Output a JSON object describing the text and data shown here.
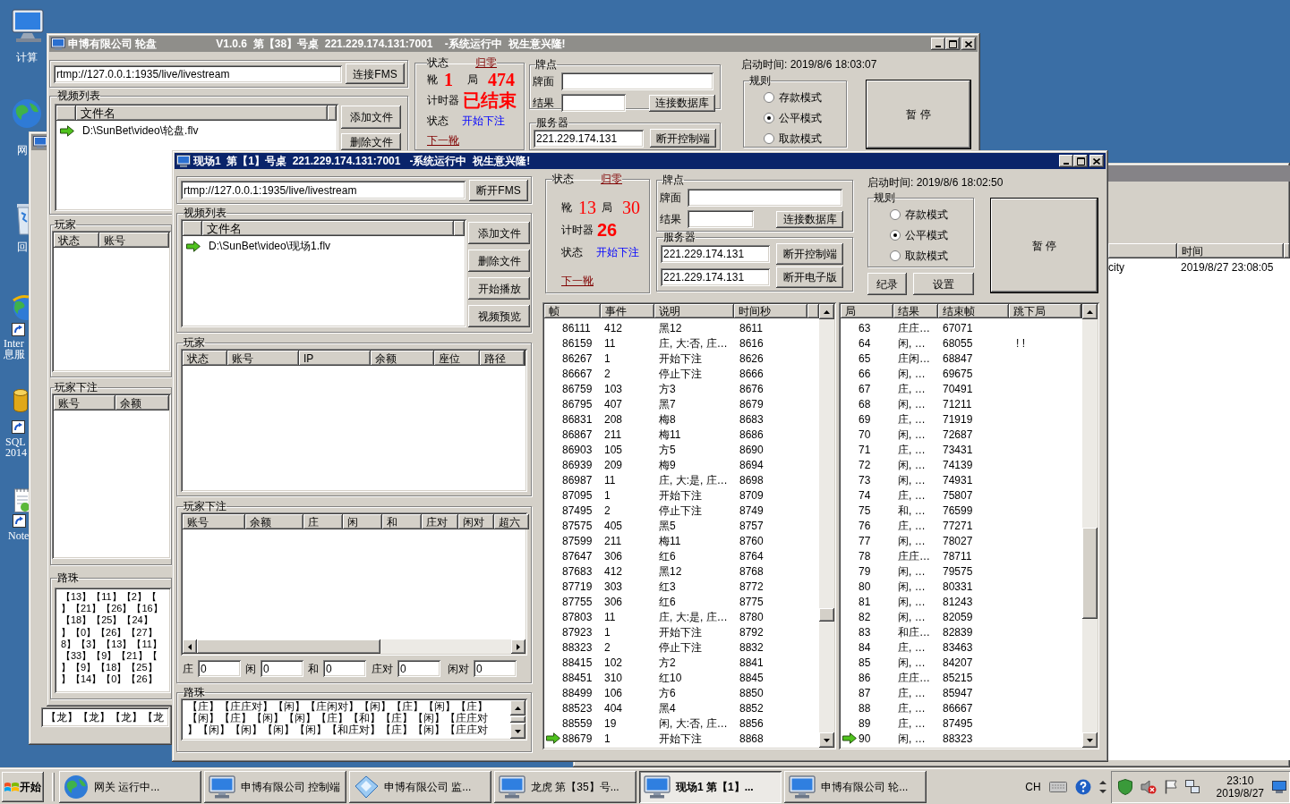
{
  "desktop_icons": [
    {
      "kind": "computer",
      "shortcut": false,
      "lines": [
        "计算"
      ]
    },
    {
      "kind": "network",
      "shortcut": false,
      "lines": [
        "网"
      ]
    },
    {
      "kind": "recycle-bin",
      "shortcut": false,
      "lines": [
        "回"
      ]
    },
    {
      "kind": "globe-app",
      "shortcut": true,
      "lines": [
        "Inter",
        "息服"
      ]
    },
    {
      "kind": "database",
      "shortcut": true,
      "lines": [
        "SQL",
        "2014"
      ]
    },
    {
      "kind": "notepad",
      "shortcut": true,
      "lines": [
        "Note"
      ]
    }
  ],
  "roulette_window": {
    "title": "申博有限公司 轮盘",
    "info": "V1.0.6  第【38】号桌  221.229.174.131:7001    -系统运行中  祝生意兴隆!",
    "active": false,
    "stream_url": "rtmp://127.0.0.1:1935/live/livestream",
    "fms_button": "连接FMS",
    "video_list": {
      "title": "视频列表",
      "column": "文件名",
      "files": [
        {
          "path": "D:\\SunBet\\video\\轮盘.flv",
          "current": true
        }
      ],
      "buttons": [
        "添加文件",
        "删除文件"
      ]
    },
    "status": {
      "title": "状态",
      "reset": "归零",
      "shoe_label": "靴",
      "shoe": "1",
      "round_label": "局",
      "round": "474",
      "timer_label": "计时器",
      "timer": "已结束",
      "state_label": "状态",
      "state": "开始下注",
      "next": "下一靴"
    },
    "cards": {
      "title": "牌点",
      "face_label": "牌面",
      "result_label": "结果",
      "button": "连接数据库"
    },
    "server": {
      "title": "服务器",
      "connections": [
        {
          "address": "221.229.174.131",
          "button": "断开控制端"
        }
      ]
    },
    "start_time": "启动时间: 2019/8/6 18:03:07",
    "rules": {
      "title": "规则",
      "options": [
        {
          "label": "存款模式",
          "selected": false
        },
        {
          "label": "公平模式",
          "selected": true
        },
        {
          "label": "取款模式",
          "selected": false
        }
      ]
    },
    "pause_button": "暂 停",
    "players": {
      "title": "玩家",
      "columns": [
        "状态",
        "账号"
      ]
    },
    "bets": {
      "title": "玩家下注",
      "columns": [
        "账号",
        "余额"
      ]
    },
    "road": {
      "title": "路珠",
      "lines": [
        "【13】【11】【2】【",
        "】【21】【26】【16】",
        "【18】【25】【24】",
        "】【0】【26】【27】",
        "8】【3】【13】【11】",
        "【33】【9】【21】【",
        "】【9】【18】【25】",
        "】【14】【0】【26】"
      ]
    }
  },
  "dragon_window": {
    "road": "【龙】【龙】【龙】【龙"
  },
  "history_window": {
    "columns": [
      "",
      "时间"
    ],
    "rows": [
      {
        "cells": [
          "city",
          "2019/8/27 23:08:05"
        ]
      }
    ]
  },
  "live_window": {
    "title": "现场1  第【1】号桌  221.229.174.131:7001   -系统运行中  祝生意兴隆!",
    "active": true,
    "stream_url": "rtmp://127.0.0.1:1935/live/livestream",
    "fms_button": "断开FMS",
    "video_list": {
      "title": "视频列表",
      "column": "文件名",
      "files": [
        {
          "path": "D:\\SunBet\\video\\现场1.flv",
          "current": true
        }
      ],
      "buttons": [
        "添加文件",
        "删除文件",
        "开始播放",
        "视频预览"
      ]
    },
    "players": {
      "title": "玩家",
      "columns": [
        "状态",
        "账号",
        "IP",
        "余额",
        "座位",
        "路径"
      ]
    },
    "bets": {
      "title": "玩家下注",
      "columns": [
        "账号",
        "余额",
        "庄",
        "闲",
        "和",
        "庄对",
        "闲对",
        "超六"
      ],
      "totals": [
        {
          "label": "庄",
          "value": "0"
        },
        {
          "label": "闲",
          "value": "0"
        },
        {
          "label": "和",
          "value": "0"
        },
        {
          "label": "庄对",
          "value": "0"
        },
        {
          "label": "闲对",
          "value": "0"
        }
      ]
    },
    "road": {
      "title": "路珠",
      "lines": [
        "【庄】【庄庄对】【闲】【庄闲对】【闲】【庄】【闲】【庄】",
        "【闲】【庄】【闲】【闲】【庄】【和】【庄】【闲】【庄庄对",
        "】【闲】【闲】【闲】【闲】【和庄对】【庄】【闲】【庄庄对"
      ]
    },
    "status": {
      "title": "状态",
      "reset": "归零",
      "shoe_label": "靴",
      "shoe": "13",
      "round_label": "局",
      "round": "30",
      "timer_label": "计时器",
      "timer": "26",
      "state_label": "状态",
      "state": "开始下注",
      "next": "下一靴"
    },
    "cards": {
      "title": "牌点",
      "face_label": "牌面",
      "result_label": "结果",
      "button": "连接数据库"
    },
    "server": {
      "title": "服务器",
      "connections": [
        {
          "address": "221.229.174.131",
          "button": "断开控制端"
        },
        {
          "address": "221.229.174.131",
          "button": "断开电子版"
        }
      ]
    },
    "start_time": "启动时间: 2019/8/6 18:02:50",
    "rules": {
      "title": "规则",
      "options": [
        {
          "label": "存款模式",
          "selected": false
        },
        {
          "label": "公平模式",
          "selected": true
        },
        {
          "label": "取款模式",
          "selected": false
        }
      ]
    },
    "rule_buttons": [
      "纪录",
      "设置"
    ],
    "pause_button": "暂 停",
    "frames": {
      "columns": [
        "帧",
        "事件",
        "说明",
        "时间秒"
      ],
      "rows": [
        {
          "frame": "86111",
          "event": "412",
          "note": "黑12",
          "second": "8611",
          "current": false
        },
        {
          "frame": "86159",
          "event": "11",
          "note": "庄, 大:否, 庄…",
          "second": "8616",
          "current": false
        },
        {
          "frame": "86267",
          "event": "1",
          "note": "开始下注",
          "second": "8626",
          "current": false
        },
        {
          "frame": "86667",
          "event": "2",
          "note": "停止下注",
          "second": "8666",
          "current": false
        },
        {
          "frame": "86759",
          "event": "103",
          "note": "方3",
          "second": "8676",
          "current": false
        },
        {
          "frame": "86795",
          "event": "407",
          "note": "黑7",
          "second": "8679",
          "current": false
        },
        {
          "frame": "86831",
          "event": "208",
          "note": "梅8",
          "second": "8683",
          "current": false
        },
        {
          "frame": "86867",
          "event": "211",
          "note": "梅11",
          "second": "8686",
          "current": false
        },
        {
          "frame": "86903",
          "event": "105",
          "note": "方5",
          "second": "8690",
          "current": false
        },
        {
          "frame": "86939",
          "event": "209",
          "note": "梅9",
          "second": "8694",
          "current": false
        },
        {
          "frame": "86987",
          "event": "11",
          "note": "庄, 大:是, 庄…",
          "second": "8698",
          "current": false
        },
        {
          "frame": "87095",
          "event": "1",
          "note": "开始下注",
          "second": "8709",
          "current": false
        },
        {
          "frame": "87495",
          "event": "2",
          "note": "停止下注",
          "second": "8749",
          "current": false
        },
        {
          "frame": "87575",
          "event": "405",
          "note": "黑5",
          "second": "8757",
          "current": false
        },
        {
          "frame": "87599",
          "event": "211",
          "note": "梅11",
          "second": "8760",
          "current": false
        },
        {
          "frame": "87647",
          "event": "306",
          "note": "红6",
          "second": "8764",
          "current": false
        },
        {
          "frame": "87683",
          "event": "412",
          "note": "黑12",
          "second": "8768",
          "current": false
        },
        {
          "frame": "87719",
          "event": "303",
          "note": "红3",
          "second": "8772",
          "current": false
        },
        {
          "frame": "87755",
          "event": "306",
          "note": "红6",
          "second": "8775",
          "current": false
        },
        {
          "frame": "87803",
          "event": "11",
          "note": "庄, 大:是, 庄…",
          "second": "8780",
          "current": false
        },
        {
          "frame": "87923",
          "event": "1",
          "note": "开始下注",
          "second": "8792",
          "current": false
        },
        {
          "frame": "88323",
          "event": "2",
          "note": "停止下注",
          "second": "8832",
          "current": false
        },
        {
          "frame": "88415",
          "event": "102",
          "note": "方2",
          "second": "8841",
          "current": false
        },
        {
          "frame": "88451",
          "event": "310",
          "note": "红10",
          "second": "8845",
          "current": false
        },
        {
          "frame": "88499",
          "event": "106",
          "note": "方6",
          "second": "8850",
          "current": false
        },
        {
          "frame": "88523",
          "event": "404",
          "note": "黑4",
          "second": "8852",
          "current": false
        },
        {
          "frame": "88559",
          "event": "19",
          "note": "闲, 大:否, 庄…",
          "second": "8856",
          "current": false
        },
        {
          "frame": "88679",
          "event": "1",
          "note": "开始下注",
          "second": "8868",
          "current": true
        }
      ]
    },
    "rounds": {
      "columns": [
        "局",
        "结果",
        "结束帧",
        "跳下局"
      ],
      "rows": [
        {
          "round": "63",
          "result": "庄庄…",
          "end_frame": "67071",
          "current": false
        },
        {
          "round": "64",
          "result": "闲, …",
          "end_frame": "68055",
          "jump": "! !",
          "current": false
        },
        {
          "round": "65",
          "result": "庄闲…",
          "end_frame": "68847",
          "current": false
        },
        {
          "round": "66",
          "result": "闲, …",
          "end_frame": "69675",
          "current": false
        },
        {
          "round": "67",
          "result": "庄, …",
          "end_frame": "70491",
          "current": false
        },
        {
          "round": "68",
          "result": "闲, …",
          "end_frame": "71211",
          "current": false
        },
        {
          "round": "69",
          "result": "庄, …",
          "end_frame": "71919",
          "current": false
        },
        {
          "round": "70",
          "result": "闲, …",
          "end_frame": "72687",
          "current": false
        },
        {
          "round": "71",
          "result": "庄, …",
          "end_frame": "73431",
          "current": false
        },
        {
          "round": "72",
          "result": "闲, …",
          "end_frame": "74139",
          "current": false
        },
        {
          "round": "73",
          "result": "闲, …",
          "end_frame": "74931",
          "current": false
        },
        {
          "round": "74",
          "result": "庄, …",
          "end_frame": "75807",
          "current": false
        },
        {
          "round": "75",
          "result": "和, …",
          "end_frame": "76599",
          "current": false
        },
        {
          "round": "76",
          "result": "庄, …",
          "end_frame": "77271",
          "current": false
        },
        {
          "round": "77",
          "result": "闲, …",
          "end_frame": "78027",
          "current": false
        },
        {
          "round": "78",
          "result": "庄庄…",
          "end_frame": "78711",
          "current": false
        },
        {
          "round": "79",
          "result": "闲, …",
          "end_frame": "79575",
          "current": false
        },
        {
          "round": "80",
          "result": "闲, …",
          "end_frame": "80331",
          "current": false
        },
        {
          "round": "81",
          "result": "闲, …",
          "end_frame": "81243",
          "current": false
        },
        {
          "round": "82",
          "result": "闲, …",
          "end_frame": "82059",
          "current": false
        },
        {
          "round": "83",
          "result": "和庄…",
          "end_frame": "82839",
          "current": false
        },
        {
          "round": "84",
          "result": "庄, …",
          "end_frame": "83463",
          "current": false
        },
        {
          "round": "85",
          "result": "闲, …",
          "end_frame": "84207",
          "current": false
        },
        {
          "round": "86",
          "result": "庄庄…",
          "end_frame": "85215",
          "current": false
        },
        {
          "round": "87",
          "result": "庄, …",
          "end_frame": "85947",
          "current": false
        },
        {
          "round": "88",
          "result": "庄, …",
          "end_frame": "86667",
          "current": false
        },
        {
          "round": "89",
          "result": "庄, …",
          "end_frame": "87495",
          "current": false
        },
        {
          "round": "90",
          "result": "闲, …",
          "end_frame": "88323",
          "current": true
        }
      ]
    }
  },
  "taskbar": {
    "start": "开始",
    "items": [
      {
        "kind": "globe",
        "label": "网关 运行中...",
        "selected": false
      },
      {
        "kind": "monitor",
        "label": "申博有限公司 控制端",
        "selected": false
      },
      {
        "kind": "note",
        "label": "申博有限公司 监...",
        "selected": false
      },
      {
        "kind": "monitor",
        "label": "龙虎 第【35】号...",
        "selected": false
      },
      {
        "kind": "monitor",
        "label": "现场1 第【1】...",
        "selected": true
      },
      {
        "kind": "monitor",
        "label": "申博有限公司 轮...",
        "selected": false
      }
    ],
    "tray": {
      "language": "CH",
      "time": "23:10",
      "date": "2019/8/27"
    }
  }
}
